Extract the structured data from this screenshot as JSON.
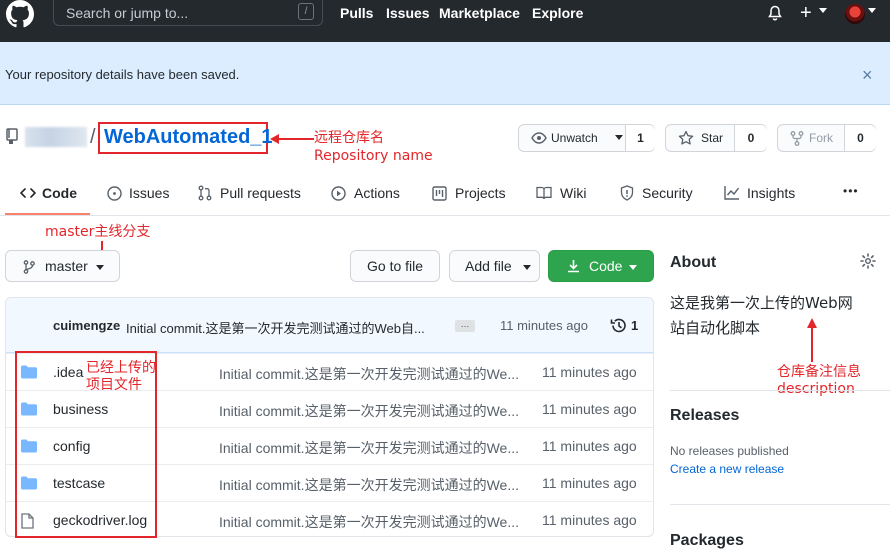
{
  "topbar": {
    "search_placeholder": "Search or jump to...",
    "slash_key": "/",
    "nav": [
      "Pulls",
      "Issues",
      "Marketplace",
      "Explore"
    ]
  },
  "flash": {
    "message": "Your repository details have been saved.",
    "close": "×"
  },
  "repo": {
    "separator": "/",
    "name": "WebAutomated_1",
    "watch": {
      "label": "Unwatch",
      "count": "1"
    },
    "star": {
      "label": "Star",
      "count": "0"
    },
    "fork": {
      "label": "Fork",
      "count": "0"
    }
  },
  "annotations": {
    "repo_name_cn": "远程仓库名",
    "repo_name_en": "Repository name",
    "branch": "master主线分支",
    "files_line1": "已经上传的",
    "files_line2": "项目文件",
    "desc_cn": "仓库备注信息",
    "desc_en": "description"
  },
  "tabs": [
    "Code",
    "Issues",
    "Pull requests",
    "Actions",
    "Projects",
    "Wiki",
    "Security",
    "Insights"
  ],
  "more": "•••",
  "toolbar": {
    "branch": "master",
    "go_to_file": "Go to file",
    "add_file": "Add file",
    "code": "Code"
  },
  "commit": {
    "author": "cuimengze",
    "message": "Initial commit.这是第一次开发完测试通过的Web自...",
    "ellipsis": "…",
    "time": "11 minutes ago",
    "count": "1"
  },
  "files": [
    {
      "name": ".idea",
      "type": "folder",
      "message": "Initial commit.这是第一次开发完测试通过的We...",
      "time": "11 minutes ago"
    },
    {
      "name": "business",
      "type": "folder",
      "message": "Initial commit.这是第一次开发完测试通过的We...",
      "time": "11 minutes ago"
    },
    {
      "name": "config",
      "type": "folder",
      "message": "Initial commit.这是第一次开发完测试通过的We...",
      "time": "11 minutes ago"
    },
    {
      "name": "testcase",
      "type": "folder",
      "message": "Initial commit.这是第一次开发完测试通过的We...",
      "time": "11 minutes ago"
    },
    {
      "name": "geckodriver.log",
      "type": "file",
      "message": "Initial commit.这是第一次开发完测试通过的We...",
      "time": "11 minutes ago"
    }
  ],
  "about": {
    "title": "About",
    "desc_line1": "这是我第一次上传的Web网",
    "desc_line2": "站自动化脚本"
  },
  "releases": {
    "title": "Releases",
    "none": "No releases published",
    "create": "Create a new release"
  },
  "packages": {
    "title": "Packages"
  },
  "colors": {
    "accent": "#0366d6",
    "annotation": "#e3262b",
    "code_button": "#2ea44f",
    "tab_underline": "#f9826c"
  }
}
